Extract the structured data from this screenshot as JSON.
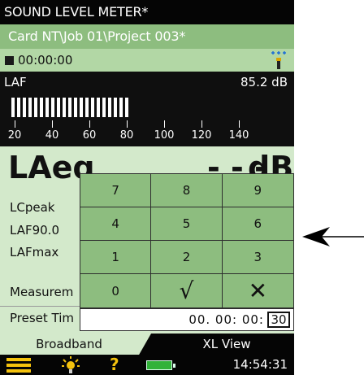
{
  "app": {
    "title": "SOUND LEVEL METER*"
  },
  "path": {
    "text": "Card NT\\Job 01\\Project 003*"
  },
  "status": {
    "elapsed": "00:00:00"
  },
  "level": {
    "label": "LAF",
    "value": "85.2 dB",
    "scale": [
      "20",
      "40",
      "60",
      "80",
      "100",
      "120",
      "140"
    ],
    "bar_db": 85.2
  },
  "main": {
    "big_param": "LAeq",
    "big_value": "- - -",
    "big_unit": "dB",
    "params": [
      "LCpeak",
      "LAF90.0",
      "LAFmax"
    ],
    "measurement_label": "Measurem",
    "preset_label": "Preset Tim"
  },
  "keypad": {
    "keys": [
      "7",
      "8",
      "9",
      "4",
      "5",
      "6",
      "1",
      "2",
      "3",
      "0",
      "√",
      "✕"
    ]
  },
  "time_entry": {
    "text": "00. 00: 00:",
    "cursor": "30"
  },
  "tabs": {
    "active": "Broadband",
    "inactive": "XL View"
  },
  "bottom": {
    "clock": "14:54:31"
  },
  "colors": {
    "accent": "#8dbd7f",
    "light": "#d3e9cb",
    "battery": "#31b239",
    "icon_yellow": "#f4c20d"
  }
}
